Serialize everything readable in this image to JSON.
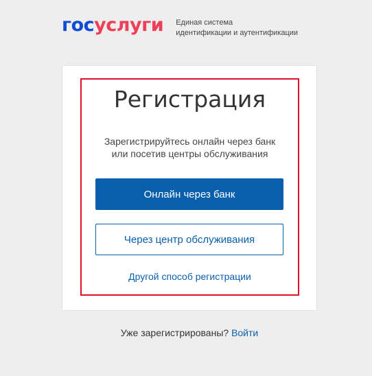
{
  "header": {
    "logo_part1": "гос",
    "logo_part2": "услуги",
    "tagline_line1": "Единая система",
    "tagline_line2": "идентификации и аутентификации"
  },
  "card": {
    "title": "Регистрация",
    "subtitle_line1": "Зарегистрируйтесь онлайн через банк",
    "subtitle_line2": "или посетив центры обслуживания",
    "bank_button": "Онлайн через банк",
    "center_button": "Через центр обслуживания",
    "other_link": "Другой способ регистрации"
  },
  "footer": {
    "question": "Уже зарегистрированы?",
    "login_link": "Войти"
  },
  "colors": {
    "brand_blue": "#0d4cd3",
    "brand_red": "#ee3f58",
    "primary": "#0a5fad",
    "highlight": "#e0102b"
  }
}
